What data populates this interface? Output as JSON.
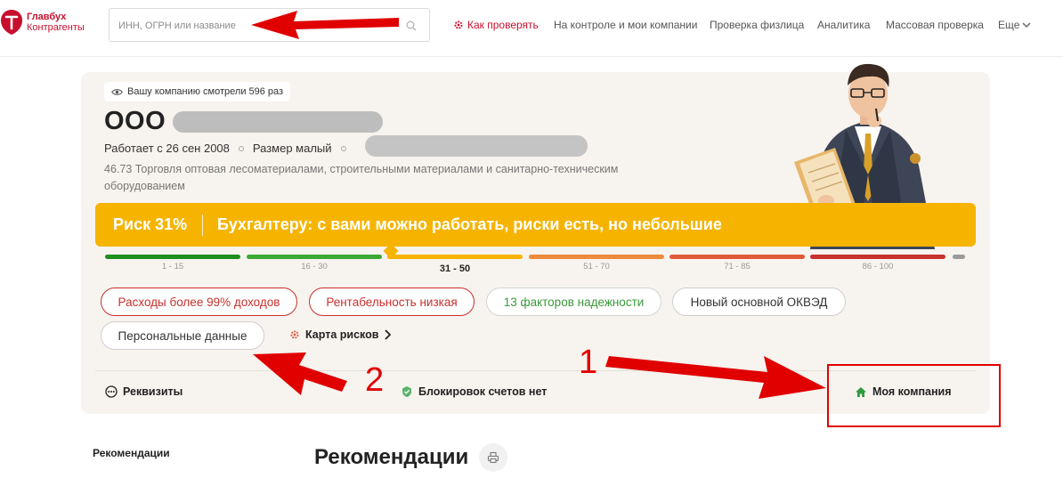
{
  "logo": {
    "line1": "Главбух",
    "line2": "Контрагенты"
  },
  "search": {
    "placeholder": "ИНН, ОГРН или название",
    "icon": "search-icon"
  },
  "nav": {
    "how_to_check": "Как проверять",
    "monitoring": "На контроле и мои компании",
    "person_check": "Проверка физлица",
    "analytics": "Аналитика",
    "mass_check": "Массовая проверка",
    "more": "Еще"
  },
  "company": {
    "views_text": "Вашу компанию смотрели 596 раз",
    "name_prefix": "ООО",
    "works_since": "Работает с 26 сен 2008",
    "size": "Размер малый",
    "okved": "46.73 Торговля оптовая лесоматериалами, строительными материалами и санитарно-техническим оборудованием"
  },
  "risk": {
    "percent_label": "Риск 31%",
    "percent_value": 31,
    "message": "Бухгалтеру: с вами можно работать, риски есть, но небольшие",
    "scale": [
      {
        "label": "1 - 15",
        "color": "#1e8f1e",
        "active": false
      },
      {
        "label": "16 - 30",
        "color": "#3aaa35",
        "active": false
      },
      {
        "label": "31 - 50",
        "color": "#f6b400",
        "active": true
      },
      {
        "label": "51 - 70",
        "color": "#ee8a3c",
        "active": false
      },
      {
        "label": "71 - 85",
        "color": "#e05a3a",
        "active": false
      },
      {
        "label": "86 - 100",
        "color": "#c8312e",
        "active": false
      }
    ]
  },
  "chips": {
    "expenses": "Расходы более 99% доходов",
    "profitability": "Рентабельность низкая",
    "reliability": "13 факторов надежности",
    "new_okved": "Новый основной ОКВЭД",
    "personal_data": "Персональные данные",
    "risk_map": "Карта рисков"
  },
  "bottom": {
    "requisites": "Реквизиты",
    "blocks": "Блокировок счетов нет",
    "my_company": "Моя компания"
  },
  "annotations": {
    "one": "1",
    "two": "2"
  },
  "recommendations": {
    "side": "Рекомендации",
    "title": "Рекомендации"
  },
  "colors": {
    "brand": "#c8102e",
    "risk_yellow": "#f6b400",
    "annotation_red": "#e00000"
  }
}
